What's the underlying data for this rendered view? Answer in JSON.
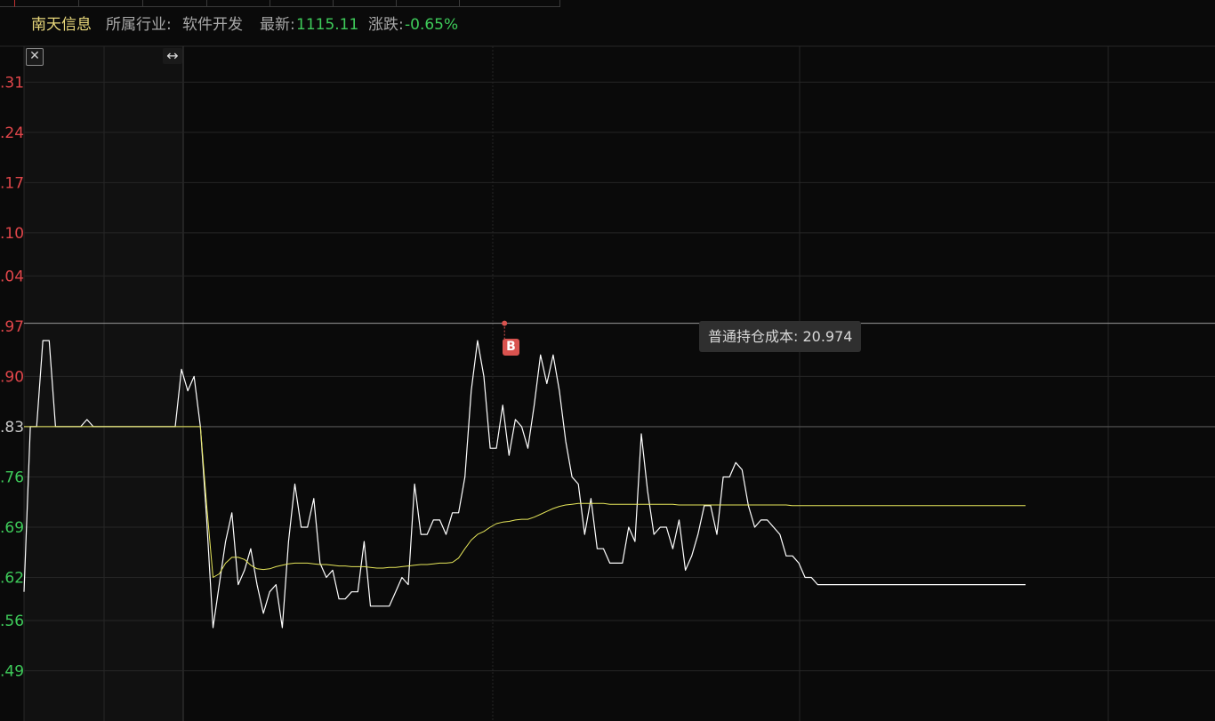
{
  "header": {
    "stock_name": "南天信息",
    "industry_label": "所属行业:",
    "industry_value": "软件开发",
    "latest_label": "最新:",
    "latest_value": "1115.11",
    "change_label": "涨跌:",
    "change_value": "-0.65%"
  },
  "controls": {
    "close_glyph": "✕",
    "resize_glyph": "↔"
  },
  "tooltip": {
    "text": "普通持仓成本: 20.974"
  },
  "marker": {
    "label": "B"
  },
  "colors": {
    "up": "#e0464a",
    "down": "#3ecb5a",
    "price_line": "#ffffff",
    "avg_line": "#e6e65a",
    "reference": "#9a9a9a",
    "marker": "#d9534f"
  },
  "chart_data": {
    "type": "line",
    "y_tick_labels": [
      ".31",
      ".24",
      ".17",
      ".10",
      ".04",
      ".97",
      ".90",
      ".83",
      ".76",
      ".69",
      ".62",
      ".56",
      ".49"
    ],
    "y_ticks": [
      21.31,
      21.24,
      21.17,
      21.1,
      21.04,
      20.97,
      20.9,
      20.83,
      20.76,
      20.69,
      20.62,
      20.56,
      20.49
    ],
    "ylim": [
      20.42,
      21.36
    ],
    "reference_price": 20.83,
    "cost_line": 20.974,
    "n_points": 160,
    "buy_index": 76,
    "series": [
      {
        "key": "price",
        "values": [
          20.6,
          20.83,
          20.83,
          20.95,
          20.95,
          20.83,
          20.83,
          20.83,
          20.83,
          20.83,
          20.84,
          20.83,
          20.83,
          20.83,
          20.83,
          20.83,
          20.83,
          20.83,
          20.83,
          20.83,
          20.83,
          20.83,
          20.83,
          20.83,
          20.83,
          20.91,
          20.88,
          20.9,
          20.83,
          20.7,
          20.55,
          20.61,
          20.67,
          20.71,
          20.61,
          20.63,
          20.66,
          20.61,
          20.57,
          20.6,
          20.61,
          20.55,
          20.67,
          20.75,
          20.69,
          20.69,
          20.73,
          20.64,
          20.62,
          20.63,
          20.59,
          20.59,
          20.6,
          20.6,
          20.67,
          20.58,
          20.58,
          20.58,
          20.58,
          20.6,
          20.62,
          20.61,
          20.75,
          20.68,
          20.68,
          20.7,
          20.7,
          20.68,
          20.71,
          20.71,
          20.76,
          20.88,
          20.95,
          20.9,
          20.8,
          20.8,
          20.86,
          20.79,
          20.84,
          20.83,
          20.8,
          20.86,
          20.93,
          20.89,
          20.93,
          20.88,
          20.81,
          20.76,
          20.75,
          20.68,
          20.73,
          20.66,
          20.66,
          20.64,
          20.64,
          20.64,
          20.69,
          20.67,
          20.82,
          20.74,
          20.68,
          20.69,
          20.69,
          20.66,
          20.7,
          20.63,
          20.65,
          20.68,
          20.72,
          20.72,
          20.68,
          20.76,
          20.76,
          20.78,
          20.77,
          20.72,
          20.69,
          20.7,
          20.7,
          20.69,
          20.68,
          20.65,
          20.65,
          20.64,
          20.62,
          20.62,
          20.61,
          20.61,
          20.61,
          20.61,
          20.61,
          20.61,
          20.61,
          20.61,
          20.61,
          20.61,
          20.61,
          20.61,
          20.61,
          20.61,
          20.61,
          20.61,
          20.61,
          20.61,
          20.61,
          20.61,
          20.61,
          20.61,
          20.61,
          20.61,
          20.61,
          20.61,
          20.61,
          20.61,
          20.61,
          20.61,
          20.61,
          20.61,
          20.61,
          20.61
        ]
      },
      {
        "key": "average",
        "values": [
          20.83,
          20.83,
          20.83,
          20.83,
          20.83,
          20.83,
          20.83,
          20.83,
          20.83,
          20.83,
          20.83,
          20.83,
          20.83,
          20.83,
          20.83,
          20.83,
          20.83,
          20.83,
          20.83,
          20.83,
          20.83,
          20.83,
          20.83,
          20.83,
          20.83,
          20.83,
          20.83,
          20.83,
          20.83,
          20.72,
          20.62,
          20.625,
          20.64,
          20.648,
          20.648,
          20.645,
          20.637,
          20.632,
          20.631,
          20.632,
          20.635,
          20.637,
          20.639,
          20.64,
          20.64,
          20.64,
          20.639,
          20.638,
          20.638,
          20.637,
          20.636,
          20.636,
          20.635,
          20.635,
          20.635,
          20.634,
          20.633,
          20.633,
          20.634,
          20.634,
          20.635,
          20.636,
          20.637,
          20.638,
          20.638,
          20.639,
          20.64,
          20.64,
          20.641,
          20.647,
          20.66,
          20.672,
          20.68,
          20.684,
          20.69,
          20.695,
          20.697,
          20.698,
          20.7,
          20.701,
          20.701,
          20.704,
          20.708,
          20.712,
          20.716,
          20.719,
          20.721,
          20.722,
          20.723,
          20.723,
          20.723,
          20.723,
          20.723,
          20.722,
          20.722,
          20.722,
          20.722,
          20.722,
          20.722,
          20.722,
          20.722,
          20.722,
          20.722,
          20.722,
          20.721,
          20.721,
          20.721,
          20.721,
          20.721,
          20.721,
          20.721,
          20.721,
          20.721,
          20.721,
          20.721,
          20.721,
          20.721,
          20.721,
          20.721,
          20.721,
          20.721,
          20.721,
          20.72,
          20.72,
          20.72,
          20.72,
          20.72,
          20.72,
          20.72,
          20.72,
          20.72,
          20.72,
          20.72,
          20.72,
          20.72,
          20.72,
          20.72,
          20.72,
          20.72,
          20.72,
          20.72,
          20.72,
          20.72,
          20.72,
          20.72,
          20.72,
          20.72,
          20.72,
          20.72,
          20.72,
          20.72,
          20.72,
          20.72,
          20.72,
          20.72,
          20.72,
          20.72,
          20.72,
          20.72,
          20.72
        ]
      }
    ]
  }
}
